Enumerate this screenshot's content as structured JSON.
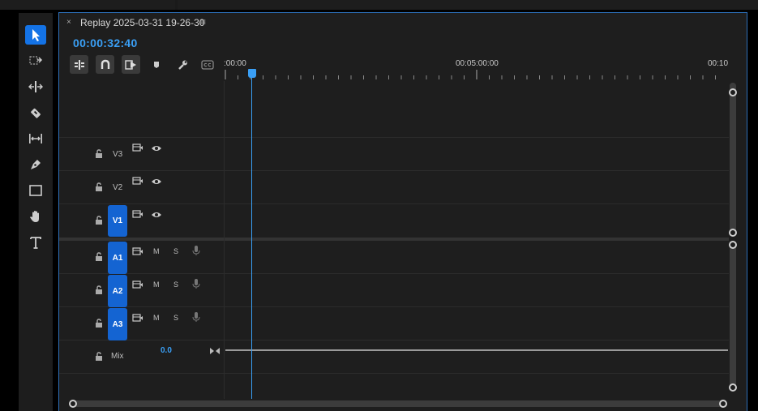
{
  "tools": [
    {
      "name": "selection-tool",
      "icon": "arrow-icon",
      "active": true
    },
    {
      "name": "track-select-tool",
      "icon": "track-select-icon",
      "active": false
    },
    {
      "name": "ripple-edit-tool",
      "icon": "ripple-edit-icon",
      "active": false
    },
    {
      "name": "razor-tool",
      "icon": "razor-icon",
      "active": false
    },
    {
      "name": "slip-tool",
      "icon": "slip-icon",
      "active": false
    },
    {
      "name": "pen-tool",
      "icon": "pen-icon",
      "active": false
    },
    {
      "name": "rectangle-tool",
      "icon": "rectangle-icon",
      "active": false
    },
    {
      "name": "hand-tool",
      "icon": "hand-icon",
      "active": false
    },
    {
      "name": "type-tool",
      "icon": "type-icon",
      "active": false
    }
  ],
  "panel": {
    "close_glyph": "×",
    "title": "Replay 2025-03-31 19-26-30",
    "menu_glyph": "≡",
    "timecode": "00:00:32:40"
  },
  "ruler": {
    "labels": [
      ":00:00",
      "00:05:00:00",
      "00:10"
    ]
  },
  "tracks": {
    "video": [
      {
        "label": "V3",
        "targeted": false
      },
      {
        "label": "V2",
        "targeted": false
      },
      {
        "label": "V1",
        "targeted": true
      }
    ],
    "audio": [
      {
        "label": "A1",
        "mute": "M",
        "solo": "S"
      },
      {
        "label": "A2",
        "mute": "M",
        "solo": "S"
      },
      {
        "label": "A3",
        "mute": "M",
        "solo": "S"
      }
    ],
    "mix": {
      "label": "Mix",
      "value": "0.0"
    }
  },
  "colors": {
    "accent": "#3a9ff5",
    "target": "#1464d2",
    "panel_border": "#2d6fb8"
  }
}
